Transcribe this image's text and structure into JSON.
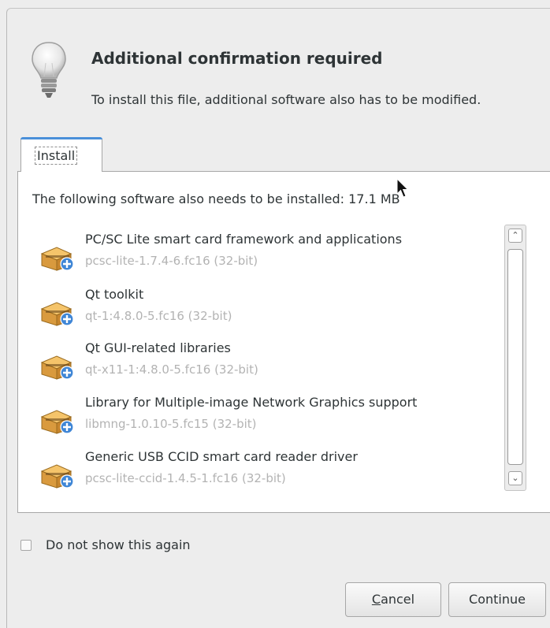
{
  "dialog": {
    "title": "Additional confirmation required",
    "subtitle": "To install this file, additional software also has to be modified."
  },
  "tabs": [
    {
      "label": "Install",
      "active": true
    }
  ],
  "install": {
    "needs_text": "The following software also needs to be installed: 17.1 MB",
    "packages": [
      {
        "name": "PC/SC Lite smart card framework and applications",
        "version": "pcsc-lite-1.7.4-6.fc16 (32-bit)"
      },
      {
        "name": "Qt toolkit",
        "version": "qt-1:4.8.0-5.fc16 (32-bit)"
      },
      {
        "name": "Qt GUI-related libraries",
        "version": "qt-x11-1:4.8.0-5.fc16 (32-bit)"
      },
      {
        "name": "Library for Multiple-image Network Graphics support",
        "version": "libmng-1.0.10-5.fc15 (32-bit)"
      },
      {
        "name": "Generic USB CCID smart card reader driver",
        "version": "pcsc-lite-ccid-1.4.5-1.fc16 (32-bit)"
      }
    ]
  },
  "footer": {
    "checkbox_label": "Do not show this again",
    "checkbox_checked": false,
    "cancel_mnemonic": "C",
    "cancel_rest": "ancel",
    "continue_label": "Continue"
  },
  "icons": {
    "header": "lightbulb-icon",
    "package": "package-add-icon"
  },
  "colors": {
    "accent": "#4a90d9",
    "version_text": "#b3b3b3",
    "background": "#ededed"
  }
}
